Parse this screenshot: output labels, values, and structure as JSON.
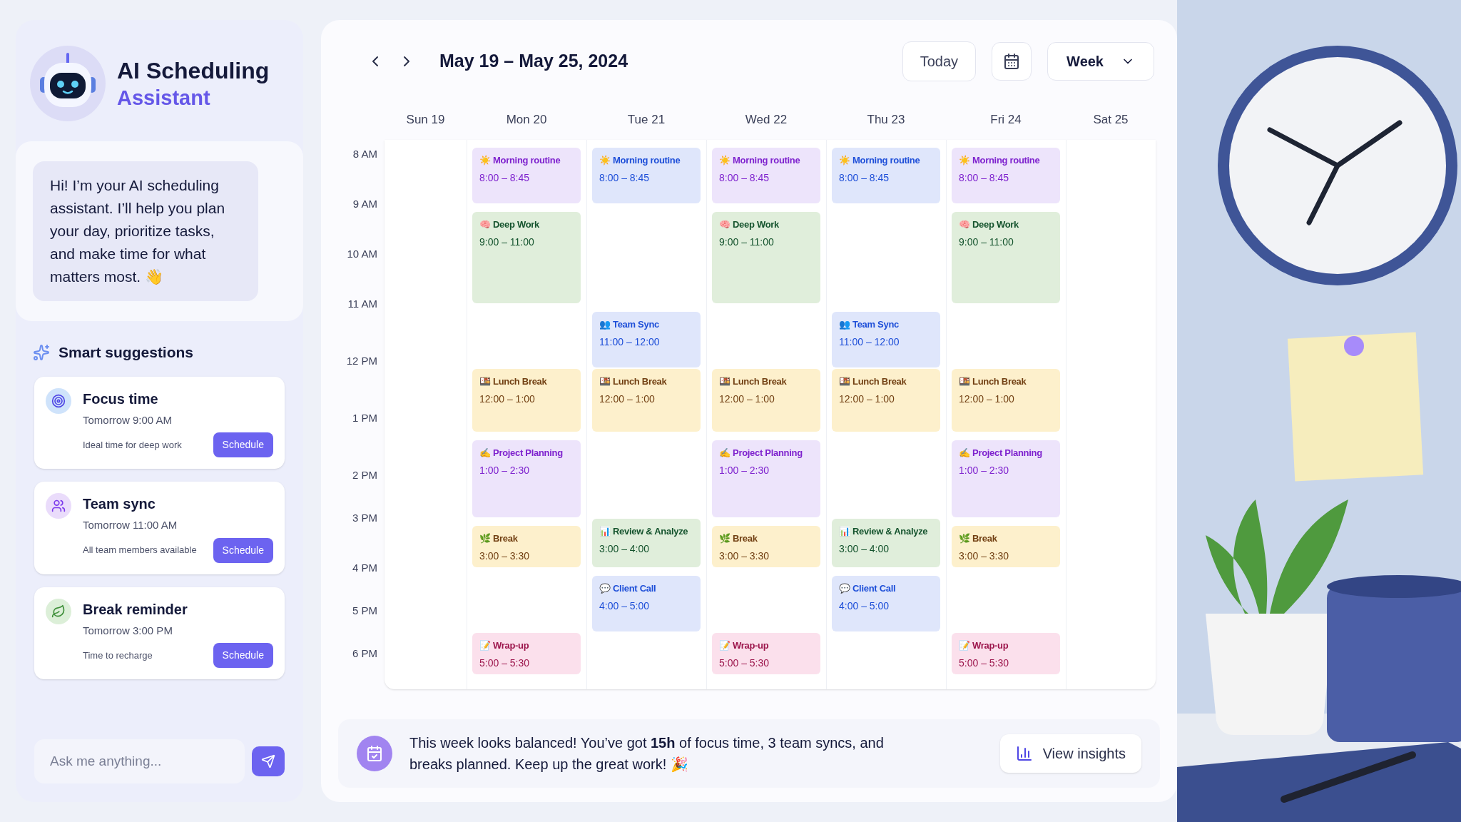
{
  "assistant": {
    "title": "AI Scheduling",
    "subtitle": "Assistant",
    "greeting": "Hi! I’m your AI scheduling assistant. I’ll help you plan your day, prioritize tasks, and make time for what matters most. 👋"
  },
  "suggestions": {
    "heading": "Smart suggestions",
    "items": [
      {
        "kind": "focus",
        "title": "Focus time",
        "when": "Tomorrow 9:00 AM",
        "note": "Ideal time for deep work",
        "button": "Schedule"
      },
      {
        "kind": "team",
        "title": "Team sync",
        "when": "Tomorrow 11:00 AM",
        "note": "All team members available",
        "button": "Schedule"
      },
      {
        "kind": "break",
        "title": "Break reminder",
        "when": "Tomorrow 3:00 PM",
        "note": "Time to recharge",
        "button": "Schedule"
      }
    ]
  },
  "chat_input": {
    "placeholder": "Ask me anything..."
  },
  "calendar": {
    "range": "May 19 – May 25, 2024",
    "today_button": "Today",
    "view": "Week",
    "hours": [
      "8 AM",
      "9 AM",
      "10 AM",
      "11 AM",
      "12 PM",
      "1 PM",
      "2 PM",
      "3 PM",
      "4 PM",
      "5 PM",
      "6 PM"
    ],
    "days": [
      {
        "label": "Sun 19"
      },
      {
        "label": "Mon 20",
        "events": [
          {
            "kind": "morning",
            "color": "#7e22ce",
            "title": "☀️ Morning routine",
            "time": "8:00 – 8:45"
          },
          {
            "kind": "deep",
            "color": "#14532d",
            "title": "🧠 Deep Work",
            "time": "9:00 – 11:00"
          },
          {
            "kind": "lunch",
            "color": "#713f12",
            "title": "🍱 Lunch Break",
            "time": "12:00 – 1:00"
          },
          {
            "kind": "planning",
            "color": "#7e22ce",
            "title": "✍️ Project Planning",
            "time": "1:00 – 2:30"
          },
          {
            "kind": "break",
            "color": "#713f12",
            "title": "🌿 Break",
            "time": "3:00 – 3:30"
          },
          {
            "kind": "wrapup",
            "color": "#9d174d",
            "title": "📝 Wrap-up",
            "time": "5:00 – 5:30"
          }
        ]
      },
      {
        "label": "Tue 21",
        "events": [
          {
            "kind": "morning",
            "color": "#1d4ed8",
            "title": "☀️ Morning routine",
            "time": "8:00 – 8:45"
          },
          {
            "kind": "sync",
            "color": "#1d4ed8",
            "title": "👥 Team Sync",
            "time": "11:00 – 12:00"
          },
          {
            "kind": "lunch",
            "color": "#713f12",
            "title": "🍱 Lunch Break",
            "time": "12:00 – 1:00"
          },
          {
            "kind": "review",
            "color": "#14532d",
            "title": "📊 Review & Analyze",
            "time": "3:00 – 4:00"
          },
          {
            "kind": "call",
            "color": "#1d4ed8",
            "title": "💬 Client Call",
            "time": "4:00 – 5:00"
          }
        ]
      },
      {
        "label": "Wed 22",
        "events": [
          {
            "kind": "morning",
            "color": "#7e22ce",
            "title": "☀️ Morning routine",
            "time": "8:00 – 8:45"
          },
          {
            "kind": "deep",
            "color": "#14532d",
            "title": "🧠 Deep Work",
            "time": "9:00 – 11:00"
          },
          {
            "kind": "lunch",
            "color": "#713f12",
            "title": "🍱 Lunch Break",
            "time": "12:00 – 1:00"
          },
          {
            "kind": "planning",
            "color": "#7e22ce",
            "title": "✍️ Project Planning",
            "time": "1:00 – 2:30"
          },
          {
            "kind": "break",
            "color": "#713f12",
            "title": "🌿 Break",
            "time": "3:00 – 3:30"
          },
          {
            "kind": "wrapup",
            "color": "#9d174d",
            "title": "📝 Wrap-up",
            "time": "5:00 – 5:30"
          }
        ]
      },
      {
        "label": "Thu 23",
        "events": [
          {
            "kind": "morning",
            "color": "#1d4ed8",
            "title": "☀️ Morning routine",
            "time": "8:00 – 8:45"
          },
          {
            "kind": "sync",
            "color": "#1d4ed8",
            "title": "👥 Team Sync",
            "time": "11:00 – 12:00"
          },
          {
            "kind": "lunch",
            "color": "#713f12",
            "title": "🍱 Lunch Break",
            "time": "12:00 – 1:00"
          },
          {
            "kind": "review",
            "color": "#14532d",
            "title": "📊 Review & Analyze",
            "time": "3:00 – 4:00"
          },
          {
            "kind": "call",
            "color": "#1d4ed8",
            "title": "💬 Client Call",
            "time": "4:00 – 5:00"
          }
        ]
      },
      {
        "label": "Fri 24",
        "events": [
          {
            "kind": "morning",
            "color": "#7e22ce",
            "title": "☀️ Morning routine",
            "time": "8:00 – 8:45"
          },
          {
            "kind": "deep",
            "color": "#14532d",
            "title": "🧠 Deep Work",
            "time": "9:00 – 11:00"
          },
          {
            "kind": "lunch",
            "color": "#713f12",
            "title": "🍱 Lunch Break",
            "time": "12:00 – 1:00"
          },
          {
            "kind": "planning",
            "color": "#7e22ce",
            "title": "✍️ Project Planning",
            "time": "1:00 – 2:30"
          },
          {
            "kind": "break",
            "color": "#713f12",
            "title": "🌿 Break",
            "time": "3:00 – 3:30"
          },
          {
            "kind": "wrapup",
            "color": "#9d174d",
            "title": "📝 Wrap-up",
            "time": "5:00 – 5:30"
          }
        ]
      },
      {
        "label": "Sat 25"
      }
    ]
  },
  "summary": {
    "text": "This week looks balanced! You’ve got **15h** of focus time, 3 team syncs, and breaks planned. Keep up the great work! 🎉",
    "button": "View insights"
  }
}
